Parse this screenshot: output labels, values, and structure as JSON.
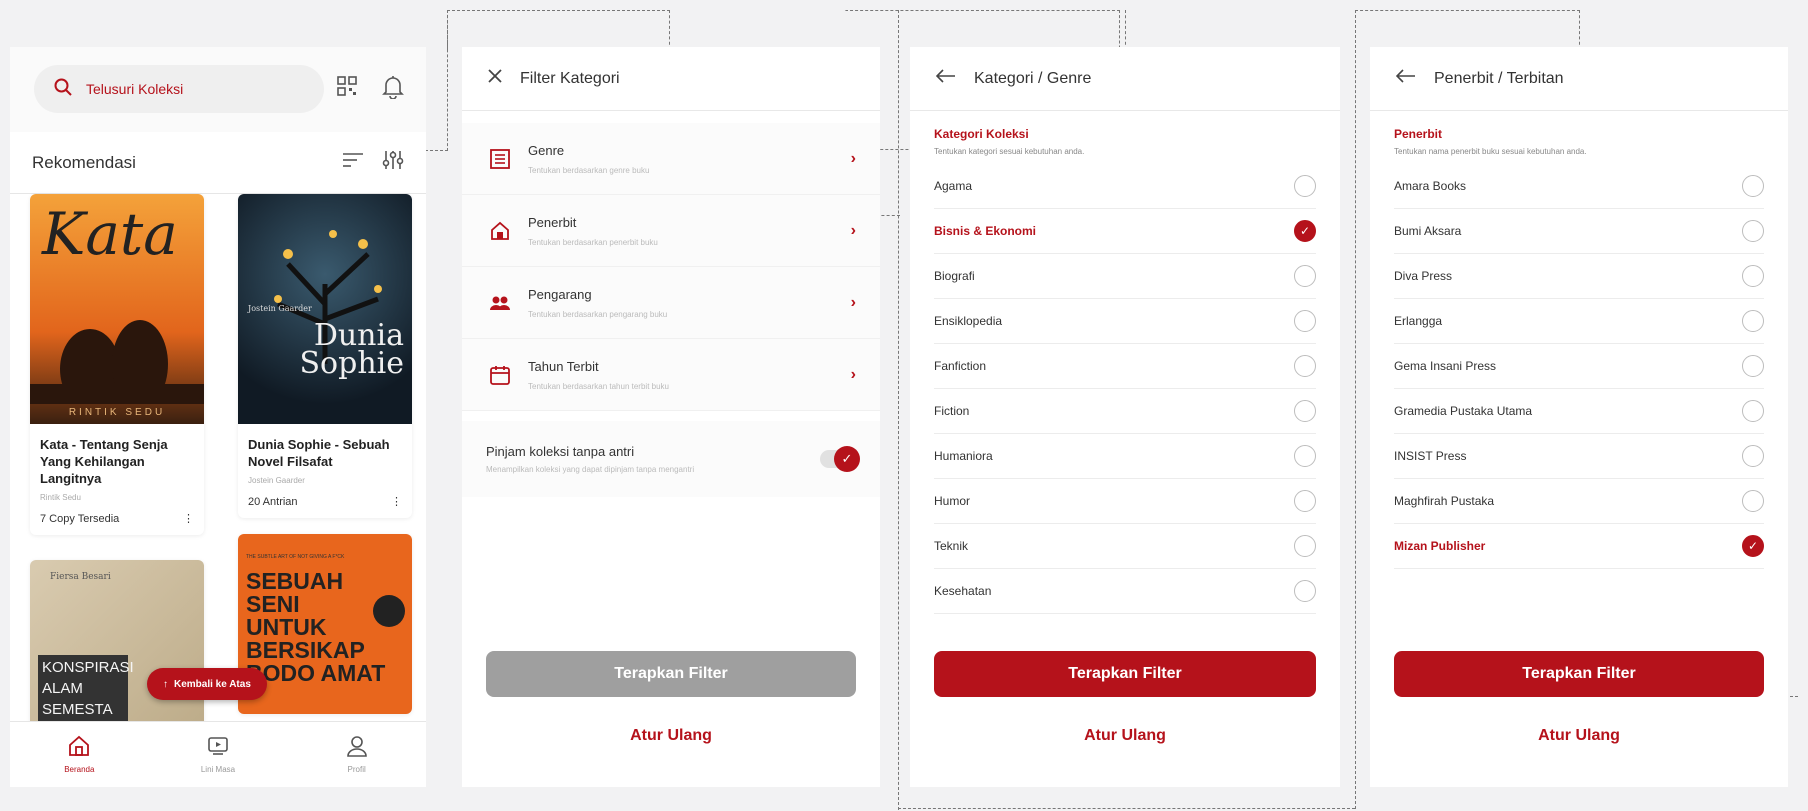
{
  "home": {
    "search_placeholder": "Telusuri Koleksi",
    "section_title": "Rekomendasi",
    "books": [
      {
        "cover_text": "Kata",
        "cover_footer": "RINTIK SEDU",
        "title": "Kata - Tentang Senja Yang Kehilangan Langitnya",
        "author": "Rintik Sedu",
        "status": "7 Copy Tersedia"
      },
      {
        "cover_text": "Dunia Sophie",
        "cover_footer": "Jostein Gaarder",
        "title": "Dunia Sophie - Sebuah Novel Filsafat",
        "author": "Jostein Gaarder",
        "status": "20 Antrian"
      },
      {
        "cover_text": "KONSPIRASI ALAM SEMESTA",
        "cover_footer": "Fiersa Besari"
      },
      {
        "cover_text": "SEBUAH SENI UNTUK BERSIKAP BODO AMAT",
        "cover_footer": "THE SUBTLE ART OF NOT GIVING A F*CK"
      }
    ],
    "back_to_top": "Kembali ke Atas",
    "nav": [
      {
        "label": "Beranda",
        "icon": "home-icon"
      },
      {
        "label": "Lini Masa",
        "icon": "timeline-icon"
      },
      {
        "label": "Profil",
        "icon": "profile-icon"
      }
    ]
  },
  "filter": {
    "title": "Filter Kategori",
    "rows": [
      {
        "label": "Genre",
        "sub": "Tentukan berdasarkan genre buku",
        "icon": "genre-icon"
      },
      {
        "label": "Penerbit",
        "sub": "Tentukan berdasarkan penerbit buku",
        "icon": "publisher-icon"
      },
      {
        "label": "Pengarang",
        "sub": "Tentukan berdasarkan pengarang buku",
        "icon": "author-icon"
      },
      {
        "label": "Tahun Terbit",
        "sub": "Tentukan berdasarkan tahun terbit buku",
        "icon": "calendar-icon"
      }
    ],
    "toggle_label": "Pinjam koleksi tanpa antri",
    "toggle_sub": "Menampilkan koleksi yang dapat dipinjam tanpa mengantri",
    "apply": "Terapkan Filter",
    "reset": "Atur Ulang"
  },
  "genre": {
    "title": "Kategori / Genre",
    "section_title": "Kategori Koleksi",
    "section_sub": "Tentukan kategori sesuai kebutuhan anda.",
    "options": [
      "Agama",
      "Bisnis & Ekonomi",
      "Biografi",
      "Ensiklopedia",
      "Fanfiction",
      "Fiction",
      "Humaniora",
      "Humor",
      "Teknik",
      "Kesehatan"
    ],
    "selected": "Bisnis & Ekonomi",
    "apply": "Terapkan Filter",
    "reset": "Atur Ulang"
  },
  "publisher": {
    "title": "Penerbit / Terbitan",
    "section_title": "Penerbit",
    "section_sub": "Tentukan nama penerbit buku sesuai kebutuhan anda.",
    "options": [
      "Amara Books",
      "Bumi Aksara",
      "Diva Press",
      "Erlangga",
      "Gema Insani Press",
      "Gramedia Pustaka Utama",
      "INSIST Press",
      "Maghfirah Pustaka",
      "Mizan Publisher"
    ],
    "selected": "Mizan Publisher",
    "apply": "Terapkan Filter",
    "reset": "Atur Ulang"
  },
  "colors": {
    "accent": "#b5121b",
    "disabled": "#9f9f9f"
  }
}
